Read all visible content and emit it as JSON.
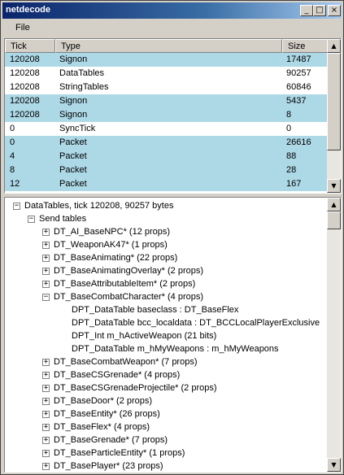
{
  "window": {
    "title": "netdecode",
    "controls": {
      "minimize": "_",
      "maximize": "□",
      "close": "×"
    }
  },
  "menu": {
    "items": [
      {
        "label": "File"
      }
    ]
  },
  "packet_list": {
    "columns": [
      "Tick",
      "Type",
      "Size"
    ],
    "rows": [
      {
        "tick": "120208",
        "type": "Signon",
        "size": "17487",
        "highlight": true
      },
      {
        "tick": "120208",
        "type": "DataTables",
        "size": "90257",
        "highlight": false
      },
      {
        "tick": "120208",
        "type": "StringTables",
        "size": "60846",
        "highlight": false
      },
      {
        "tick": "120208",
        "type": "Signon",
        "size": "5437",
        "highlight": true
      },
      {
        "tick": "120208",
        "type": "Signon",
        "size": "8",
        "highlight": true
      },
      {
        "tick": "0",
        "type": "SyncTick",
        "size": "0",
        "highlight": false
      },
      {
        "tick": "0",
        "type": "Packet",
        "size": "26616",
        "highlight": true
      },
      {
        "tick": "4",
        "type": "Packet",
        "size": "88",
        "highlight": true
      },
      {
        "tick": "8",
        "type": "Packet",
        "size": "28",
        "highlight": true
      },
      {
        "tick": "12",
        "type": "Packet",
        "size": "167",
        "highlight": true
      }
    ]
  },
  "tree": {
    "nodes": [
      {
        "label": "DataTables, tick 120208, 90257 bytes",
        "level": 0,
        "expander": "minus"
      },
      {
        "label": "Send tables",
        "level": 1,
        "expander": "minus"
      },
      {
        "label": "DT_AI_BaseNPC* (12 props)",
        "level": 2,
        "expander": "plus"
      },
      {
        "label": "DT_WeaponAK47* (1 props)",
        "level": 2,
        "expander": "plus"
      },
      {
        "label": "DT_BaseAnimating* (22 props)",
        "level": 2,
        "expander": "plus"
      },
      {
        "label": "DT_BaseAnimatingOverlay* (2 props)",
        "level": 2,
        "expander": "plus"
      },
      {
        "label": "DT_BaseAttributableItem* (2 props)",
        "level": 2,
        "expander": "plus"
      },
      {
        "label": "DT_BaseCombatCharacter* (4 props)",
        "level": 2,
        "expander": "minus"
      },
      {
        "label": "DPT_DataTable baseclass : DT_BaseFlex",
        "level": 3,
        "expander": "none"
      },
      {
        "label": "DPT_DataTable bcc_localdata : DT_BCCLocalPlayerExclusive",
        "level": 3,
        "expander": "none"
      },
      {
        "label": "DPT_Int m_hActiveWeapon (21 bits)",
        "level": 3,
        "expander": "none"
      },
      {
        "label": "DPT_DataTable m_hMyWeapons : m_hMyWeapons",
        "level": 3,
        "expander": "none"
      },
      {
        "label": "DT_BaseCombatWeapon* (7 props)",
        "level": 2,
        "expander": "plus"
      },
      {
        "label": "DT_BaseCSGrenade* (4 props)",
        "level": 2,
        "expander": "plus"
      },
      {
        "label": "DT_BaseCSGrenadeProjectile* (2 props)",
        "level": 2,
        "expander": "plus"
      },
      {
        "label": "DT_BaseDoor* (2 props)",
        "level": 2,
        "expander": "plus"
      },
      {
        "label": "DT_BaseEntity* (26 props)",
        "level": 2,
        "expander": "plus"
      },
      {
        "label": "DT_BaseFlex* (4 props)",
        "level": 2,
        "expander": "plus"
      },
      {
        "label": "DT_BaseGrenade* (7 props)",
        "level": 2,
        "expander": "plus"
      },
      {
        "label": "DT_BaseParticleEntity* (1 props)",
        "level": 2,
        "expander": "plus"
      },
      {
        "label": "DT_BasePlayer* (23 props)",
        "level": 2,
        "expander": "plus"
      }
    ]
  },
  "scroll_icons": {
    "up": "▲",
    "down": "▼"
  },
  "colors": {
    "highlight": "#add8e6",
    "title_start": "#0a246a",
    "title_end": "#a6caf0"
  }
}
